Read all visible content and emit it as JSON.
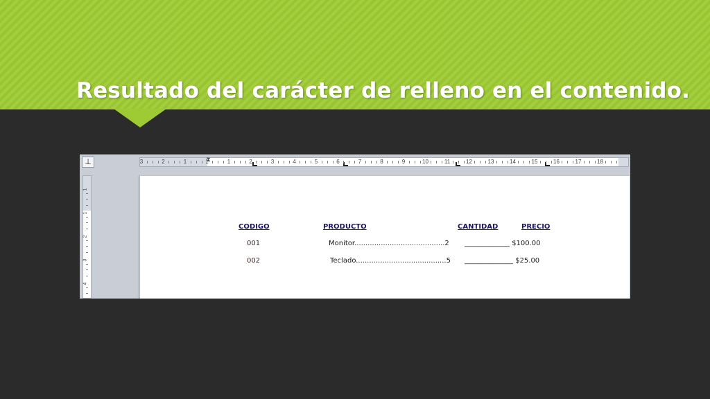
{
  "slide": {
    "title": "Resultado del carácter de relleno en el contenido.",
    "colors": {
      "header": "#9ecb33",
      "background": "#2b2b2b"
    }
  },
  "screenshot": {
    "tab_selector_glyph": "⊥",
    "ruler": {
      "labels": [
        "3",
        "2",
        "1",
        "1",
        "1",
        "2",
        "3",
        "4",
        "5",
        "6",
        "7",
        "8",
        "9",
        "10",
        "11",
        "12",
        "13",
        "14",
        "15",
        "16",
        "17",
        "18"
      ]
    },
    "vertical_ruler": {
      "labels": [
        "1",
        "1",
        "2",
        "3",
        "4"
      ]
    },
    "document": {
      "headers": {
        "codigo": "CODIGO",
        "producto": "PRODUCTO",
        "cantidad": "CANTIDAD",
        "precio": "PRECIO"
      },
      "rows": [
        {
          "codigo": "001",
          "producto_leader": "Monitor.........................................2",
          "precio_leader": "_____________  $100.00"
        },
        {
          "codigo": "002",
          "producto_leader": "Teclado.........................................5",
          "precio_leader": "______________  $25.00"
        }
      ]
    }
  }
}
